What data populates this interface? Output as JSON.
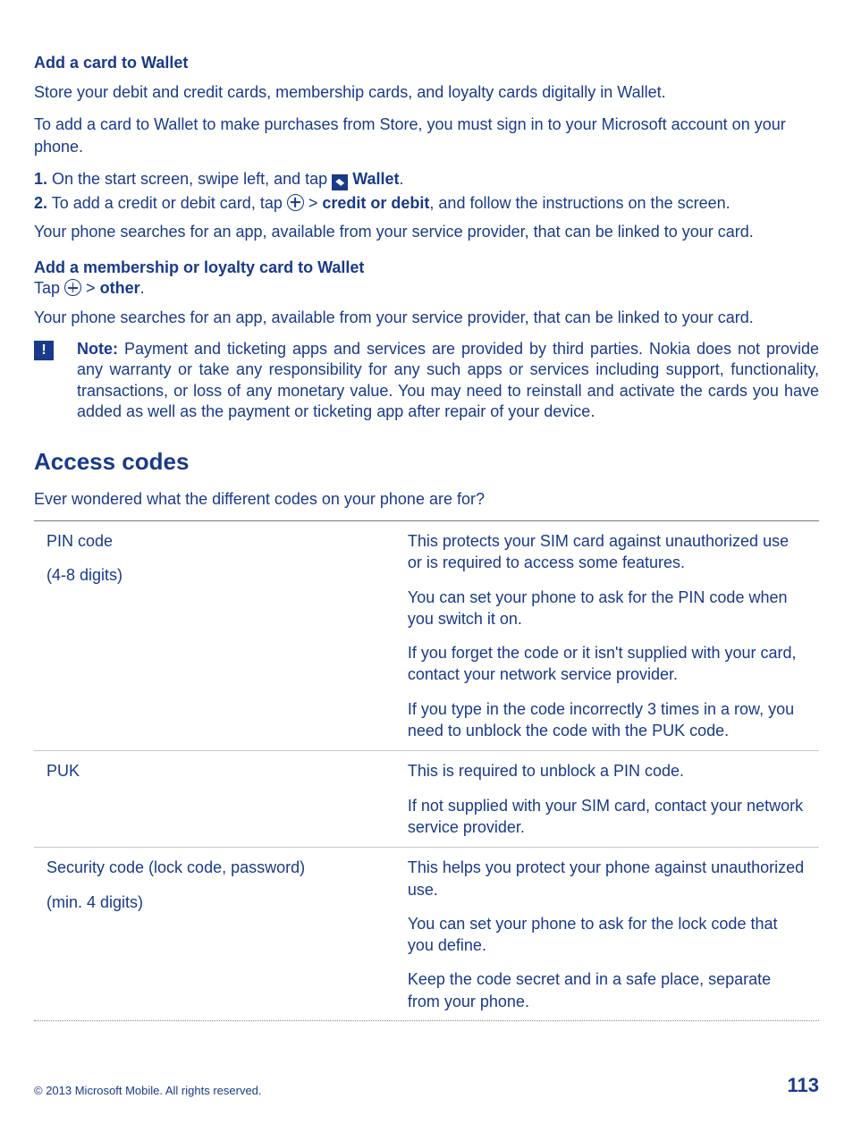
{
  "section1": {
    "title": "Add a card to Wallet",
    "intro": "Store your debit and credit cards, membership cards, and loyalty cards digitally in Wallet.",
    "signin": "To add a card to Wallet to make purchases from Store, you must sign in to your Microsoft account on your phone.",
    "step1_num": "1.",
    "step1_text": " On the start screen, swipe left, and tap ",
    "step1_wallet": "Wallet",
    "step2_num": "2.",
    "step2_text_a": " To add a credit or debit card, tap ",
    "step2_cod": "credit or debit",
    "step2_text_b": ", and follow the instructions on the screen.",
    "searches": "Your phone searches for an app, available from your service provider, that can be linked to your card.",
    "sub2": "Add a membership or loyalty card to Wallet",
    "tap_prefix": "Tap ",
    "other": "other",
    "searches2": "Your phone searches for an app, available from your service provider, that can be linked to your card.",
    "note_label": "Note:",
    "note_text": " Payment and ticketing apps and services are provided by third parties. Nokia does not provide any warranty or take any responsibility for any such apps or services including support, functionality, transactions, or loss of any monetary value. You may need to reinstall and activate the cards you have added as well as the payment or ticketing app after repair of your device."
  },
  "section2": {
    "title": "Access codes",
    "intro": "Ever wondered what the different codes on your phone are for?",
    "rows": {
      "pin_name": "PIN code",
      "pin_sub": "(4-8 digits)",
      "pin_p1": "This protects your SIM card against unauthorized use or is required to access some features.",
      "pin_p2": "You can set your phone to ask for the PIN code when you switch it on.",
      "pin_p3": "If you forget the code or it isn't supplied with your card, contact your network service provider.",
      "pin_p4": "If you type in the code incorrectly 3 times in a row, you need to unblock the code with the PUK code.",
      "puk_name": "PUK",
      "puk_p1": "This is required to unblock a PIN code.",
      "puk_p2": "If not supplied with your SIM card, contact your network service provider.",
      "sec_name": "Security code (lock code, password)",
      "sec_sub": "(min. 4 digits)",
      "sec_p1": "This helps you protect your phone against unauthorized use.",
      "sec_p2": "You can set your phone to ask for the lock code that you define.",
      "sec_p3": "Keep the code secret and in a safe place, separate from your phone."
    }
  },
  "footer": {
    "copyright": "© 2013 Microsoft Mobile. All rights reserved.",
    "page": "113"
  }
}
